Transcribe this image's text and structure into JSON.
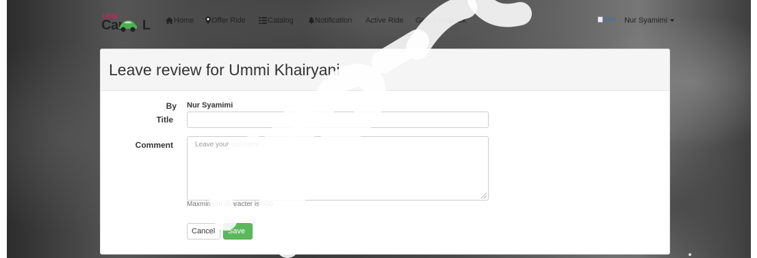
{
  "navbar": {
    "logo": {
      "top_letters": "UKM",
      "text": "Car",
      "suffix": "L"
    },
    "items": [
      {
        "label": "Home",
        "icon": "home-icon"
      },
      {
        "label": "Offer Ride",
        "icon": "map-marker-icon"
      },
      {
        "label": "Catalog",
        "icon": "list-icon"
      },
      {
        "label": "Notification",
        "icon": "bell-icon"
      },
      {
        "label": "Active Ride"
      },
      {
        "label": "Give Feedback"
      }
    ],
    "user": {
      "avatar_alt": "ima",
      "name": "Nur Syamimi"
    }
  },
  "panel": {
    "title": "Leave review for Ummi Khairyani"
  },
  "form": {
    "by_label": "By",
    "by_value": "Nur Syamimi",
    "title_label": "Title",
    "title_value": "",
    "comment_label": "Comment",
    "comment_placeholder": "Leave your comment",
    "help_text": "Maxmimum character is 500",
    "cancel_label": "Cancel",
    "save_label": "Save"
  },
  "colors": {
    "accent_green": "#5cb85c",
    "logo_pink": "#d81b60",
    "logo_green": "#4caf50"
  }
}
